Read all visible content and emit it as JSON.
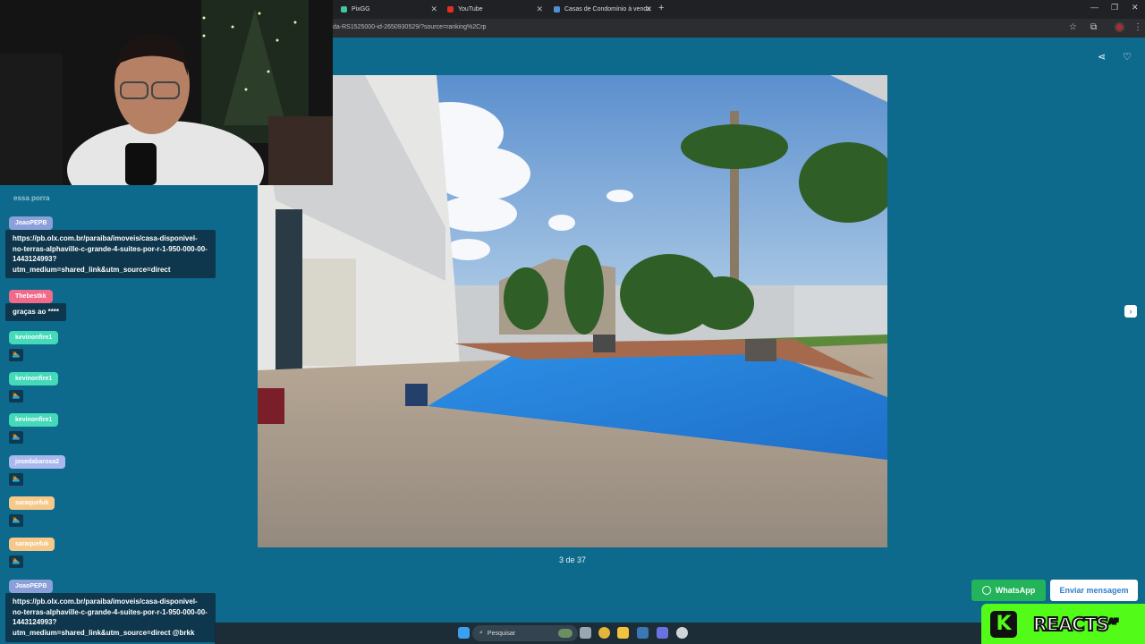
{
  "browser": {
    "tabs": [
      {
        "label": "PixGG",
        "color": "#41c79a"
      },
      {
        "label": "YouTube",
        "color": "#e52d27"
      },
      {
        "label": "Casas de Condomínio à venda",
        "color": "#4e8fd6"
      }
    ],
    "url": "da-RS1525000-id-2650930529/?source=ranking%2Crp"
  },
  "listing": {
    "counter": "3 de 37",
    "whatsapp_label": "WhatsApp",
    "message_label": "Enviar mensagem"
  },
  "overlay": {
    "kick_logo": "K",
    "kick_label": "REACTS",
    "kick_superscript": "AF"
  },
  "taskbar": {
    "search_placeholder": "Pesquisar"
  },
  "chat": {
    "faded_text": "essa porra",
    "messages": [
      {
        "user": "JoaoPEPB",
        "color": "#8ba0d8",
        "text": "https://pb.olx.com.br/paraiba/imoveis/casa-disponivel-no-terras-alphaville-c-grande-4-suites-por-r-1-950-000-00-1443124993?utm_medium=shared_link&utm_source=direct"
      },
      {
        "user": "Thebestkk",
        "color": "#f16a8a",
        "text": "graças ao ****"
      },
      {
        "user": "kevinonfire1",
        "color": "#44d9b8",
        "text": "🏊"
      },
      {
        "user": "kevinonfire1",
        "color": "#44d9b8",
        "text": "🏊"
      },
      {
        "user": "kevinonfire1",
        "color": "#44d9b8",
        "text": "🏊"
      },
      {
        "user": "josedabarosa2",
        "color": "#a9b9ee",
        "text": "🏊"
      },
      {
        "user": "saraquefuk",
        "color": "#f6c98a",
        "text": "🏊"
      },
      {
        "user": "saraquefuk",
        "color": "#f6c98a",
        "text": "🏊"
      },
      {
        "user": "JoaoPEPB",
        "color": "#8ba0d8",
        "text": "https://pb.olx.com.br/paraiba/imoveis/casa-disponivel-no-terras-alphaville-c-grande-4-suites-por-r-1-950-000-00-1443124993?utm_medium=shared_link&utm_source=direct @brkk"
      }
    ]
  }
}
